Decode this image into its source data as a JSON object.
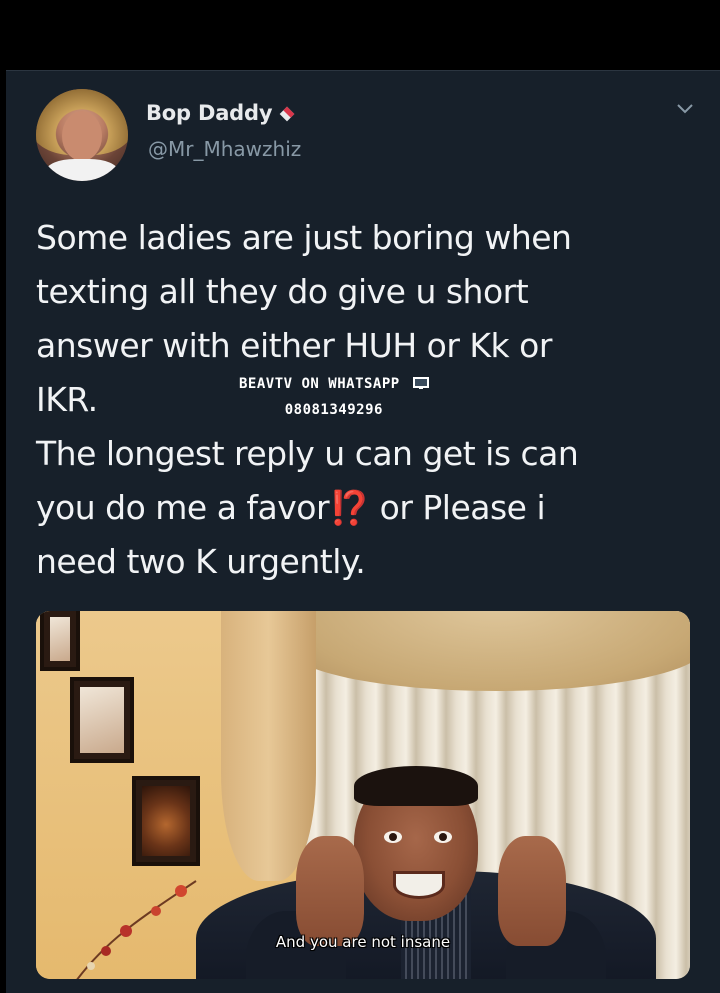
{
  "tweet": {
    "display_name": "Bop Daddy",
    "name_badge_icon": "heart-tag-icon",
    "handle": "@Mr_Mhawzhiz",
    "menu_icon": "chevron-down-icon",
    "text_lines": [
      "Some ladies are just boring when",
      "texting all they do give u short",
      "answer with either HUH or Kk or",
      "IKR.",
      "The longest reply u can get is can",
      "you do me a favor",
      "or Please i",
      "need two K urgently."
    ],
    "interrobang": "⁉️",
    "accent_color": "#e0245e"
  },
  "watermark": {
    "line1": "BEAVTV ON WHATSAPP",
    "icon": "tv-icon",
    "line2": "08081349296"
  },
  "media": {
    "caption": "And you are not insane"
  },
  "colors": {
    "background": "#17202a",
    "primary_text": "#f1f3f5",
    "secondary_text": "#8899a6"
  }
}
